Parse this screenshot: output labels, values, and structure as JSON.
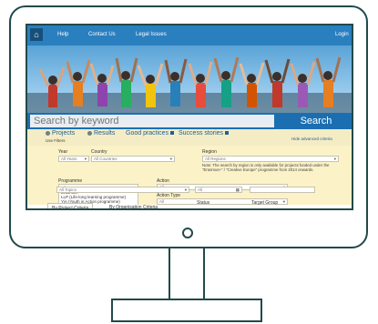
{
  "topnav": {
    "home_icon": "home-icon",
    "items": [
      "Help",
      "Contact Us",
      "Legal Issues"
    ],
    "login": "Login"
  },
  "search": {
    "placeholder": "Search by keyword",
    "button": "Search"
  },
  "tabs": {
    "items": [
      "Projects",
      "Results",
      "Good practices",
      "Success stories"
    ],
    "use_filters": "Use Filters",
    "hide_advanced": "Hide advanced criteria"
  },
  "filters": {
    "year_label": "Year",
    "year_value": "All Years",
    "country_label": "Country",
    "country_value": "All Countries",
    "region_label": "Region",
    "region_value": "All Regions",
    "region_note": "Note: The search by region is only available for projects funded under the \"Erasmus+\" / \"Creative Europe\" programme from 2014 onwards.",
    "programme_label": "Programme",
    "programme_options": [
      "All",
      "Erasmus+",
      "LLP (Life-long learning programme)",
      "YiA (Youth in Action programme)"
    ],
    "action_label": "Action",
    "action_value": "All",
    "action_type_label": "Action Type",
    "action_type_value": "All",
    "topic_label": "Topic",
    "topic_value": "All Topics",
    "status_label": "Status",
    "status_value": "All",
    "target_group_label": "Target Group",
    "target_group_value": ""
  },
  "bottom_tabs": [
    "By Project Criteria",
    "By Organisation Criteria"
  ],
  "colors": {
    "nav": "#2a7fbf",
    "search_bar": "#1b6fb1",
    "panel": "#fbf2c8",
    "outline": "#22494a"
  }
}
